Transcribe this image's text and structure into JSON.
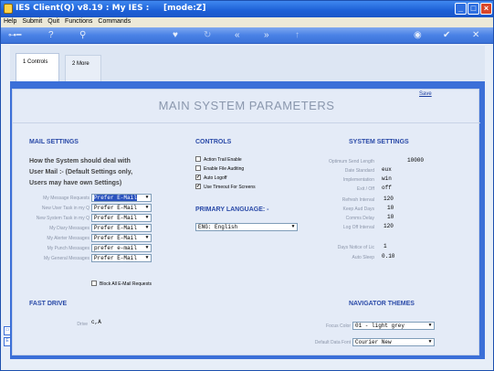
{
  "window": {
    "title": "IES Client(Q) v8.19 : My IES :     [mode:Z]"
  },
  "menu": [
    "Help",
    "Submit",
    "Quit",
    "Functions",
    "Commands"
  ],
  "tabs": [
    {
      "label": "1 Controls",
      "active": true
    },
    {
      "label": "2 More",
      "active": false
    }
  ],
  "page": {
    "save_label": "Save",
    "title": "MAIN SYSTEM PARAMETERS"
  },
  "mail": {
    "heading": "MAIL SETTINGS",
    "description": [
      "How the System should deal with",
      "User Mail :- (Default Settings only,",
      "Users may have own Settings)"
    ],
    "fields": [
      {
        "label": "My Message Requests",
        "value": "Prefer E-Mail",
        "highlighted": true
      },
      {
        "label": "New User Task in my Q",
        "value": "Prefer E-Mail"
      },
      {
        "label": "New System Task in my Q",
        "value": "Prefer E-Mail"
      },
      {
        "label": "My Diary Messages",
        "value": "Prefer E-Mail"
      },
      {
        "label": "My Alerter Messages",
        "value": "Prefer E-Mail"
      },
      {
        "label": "My Punch Messages",
        "value": "prefer e-mail"
      },
      {
        "label": "My General Messages",
        "value": "Prefer E-Mail"
      }
    ],
    "block_label": "Block All E-Mail Requests",
    "block_checked": false
  },
  "controls": {
    "heading": "CONTROLS",
    "items": [
      {
        "label": "Action Trail Enable",
        "checked": false
      },
      {
        "label": "Enable File Auditing",
        "checked": false
      },
      {
        "label": "Auto Logoff",
        "checked": true
      },
      {
        "label": "Use Timeout For Screens",
        "checked": true
      }
    ],
    "language_heading": "PRIMARY LANGUAGE: -",
    "language_value": "ENG: English"
  },
  "system": {
    "heading": "SYSTEM SETTINGS",
    "fields": [
      {
        "label": "Optimum Send Length",
        "value": "10000"
      },
      {
        "label": "Date Standard",
        "value": "eux"
      },
      {
        "label": "Implementation",
        "value": "win"
      },
      {
        "label": "Exit / Off",
        "value": "off"
      },
      {
        "label": "Refresh Interval",
        "value": "120"
      },
      {
        "label": "Keep Aud Days",
        "value": "10"
      },
      {
        "label": "Comms Delay",
        "value": "10"
      },
      {
        "label": "Log Off Interval",
        "value": "120"
      },
      {
        "label": "Days Notice of Lic",
        "value": "1"
      },
      {
        "label": "Auto Sleep",
        "value": "0.10"
      }
    ]
  },
  "fast_drive": {
    "heading": "FAST DRIVE",
    "drive_label": "Drive",
    "drive_value": "c,A"
  },
  "navigator": {
    "heading": "NAVIGATOR THEMES",
    "focus_label": "Focus Color",
    "focus_value": "01 - light grey",
    "font_label": "Default Data Font",
    "font_value": "Courier New"
  },
  "icons": [
    "app-icon",
    "minimize-icon",
    "maximize-icon",
    "close-icon",
    "key-icon",
    "help-icon",
    "search-icon",
    "heart-icon",
    "prev-icon",
    "next-icon",
    "globe-icon",
    "check-icon",
    "x-icon"
  ]
}
